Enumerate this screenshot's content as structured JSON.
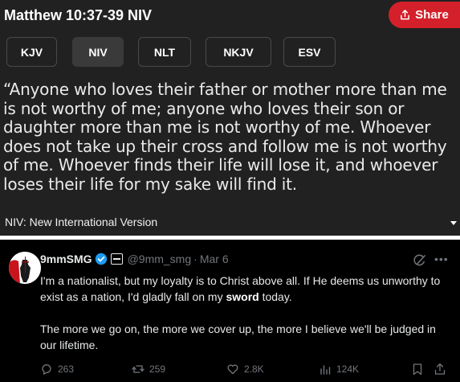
{
  "bible": {
    "reference": "Matthew 10:37-39 NIV",
    "share_label": "Share",
    "versions": [
      "KJV",
      "NIV",
      "NLT",
      "NKJV",
      "ESV"
    ],
    "active_version": "NIV",
    "verse": "“Anyone who loves their father or mother more than me is not worthy of me; anyone who loves their son or daughter more than me is not worthy of me. Whoever does not take up their cross and follow me is not worthy of me. Whoever finds their life will lose it, and whoever loses their life for my sake will find it.",
    "version_name": "NIV: New International Version",
    "colors": {
      "background": "#212121",
      "share": "#d4202a"
    }
  },
  "tweet": {
    "display_name": "9mmSMG",
    "handle": "@9mm_smg",
    "separator": "·",
    "date": "Mar 6",
    "paragraph1_before": "I'm a nationalist, but my loyalty is to Christ above all. If He deems us unworthy to exist as a nation, I'd gladly fall on my ",
    "paragraph1_bold": "sword",
    "paragraph1_after": " today.",
    "paragraph2": "The more we go on, the more we cover up, the more I believe we'll be judged in our lifetime.",
    "replies": "263",
    "reposts": "259",
    "likes": "2.8K",
    "views": "124K",
    "icons": [
      "verified-icon",
      "flag-icon",
      "grok-icon",
      "more-icon",
      "reply-icon",
      "repost-icon",
      "like-icon",
      "views-icon",
      "bookmark-icon",
      "share-icon"
    ],
    "colors": {
      "background": "#000000",
      "verified": "#1d9bf0",
      "muted": "#71767b"
    }
  }
}
